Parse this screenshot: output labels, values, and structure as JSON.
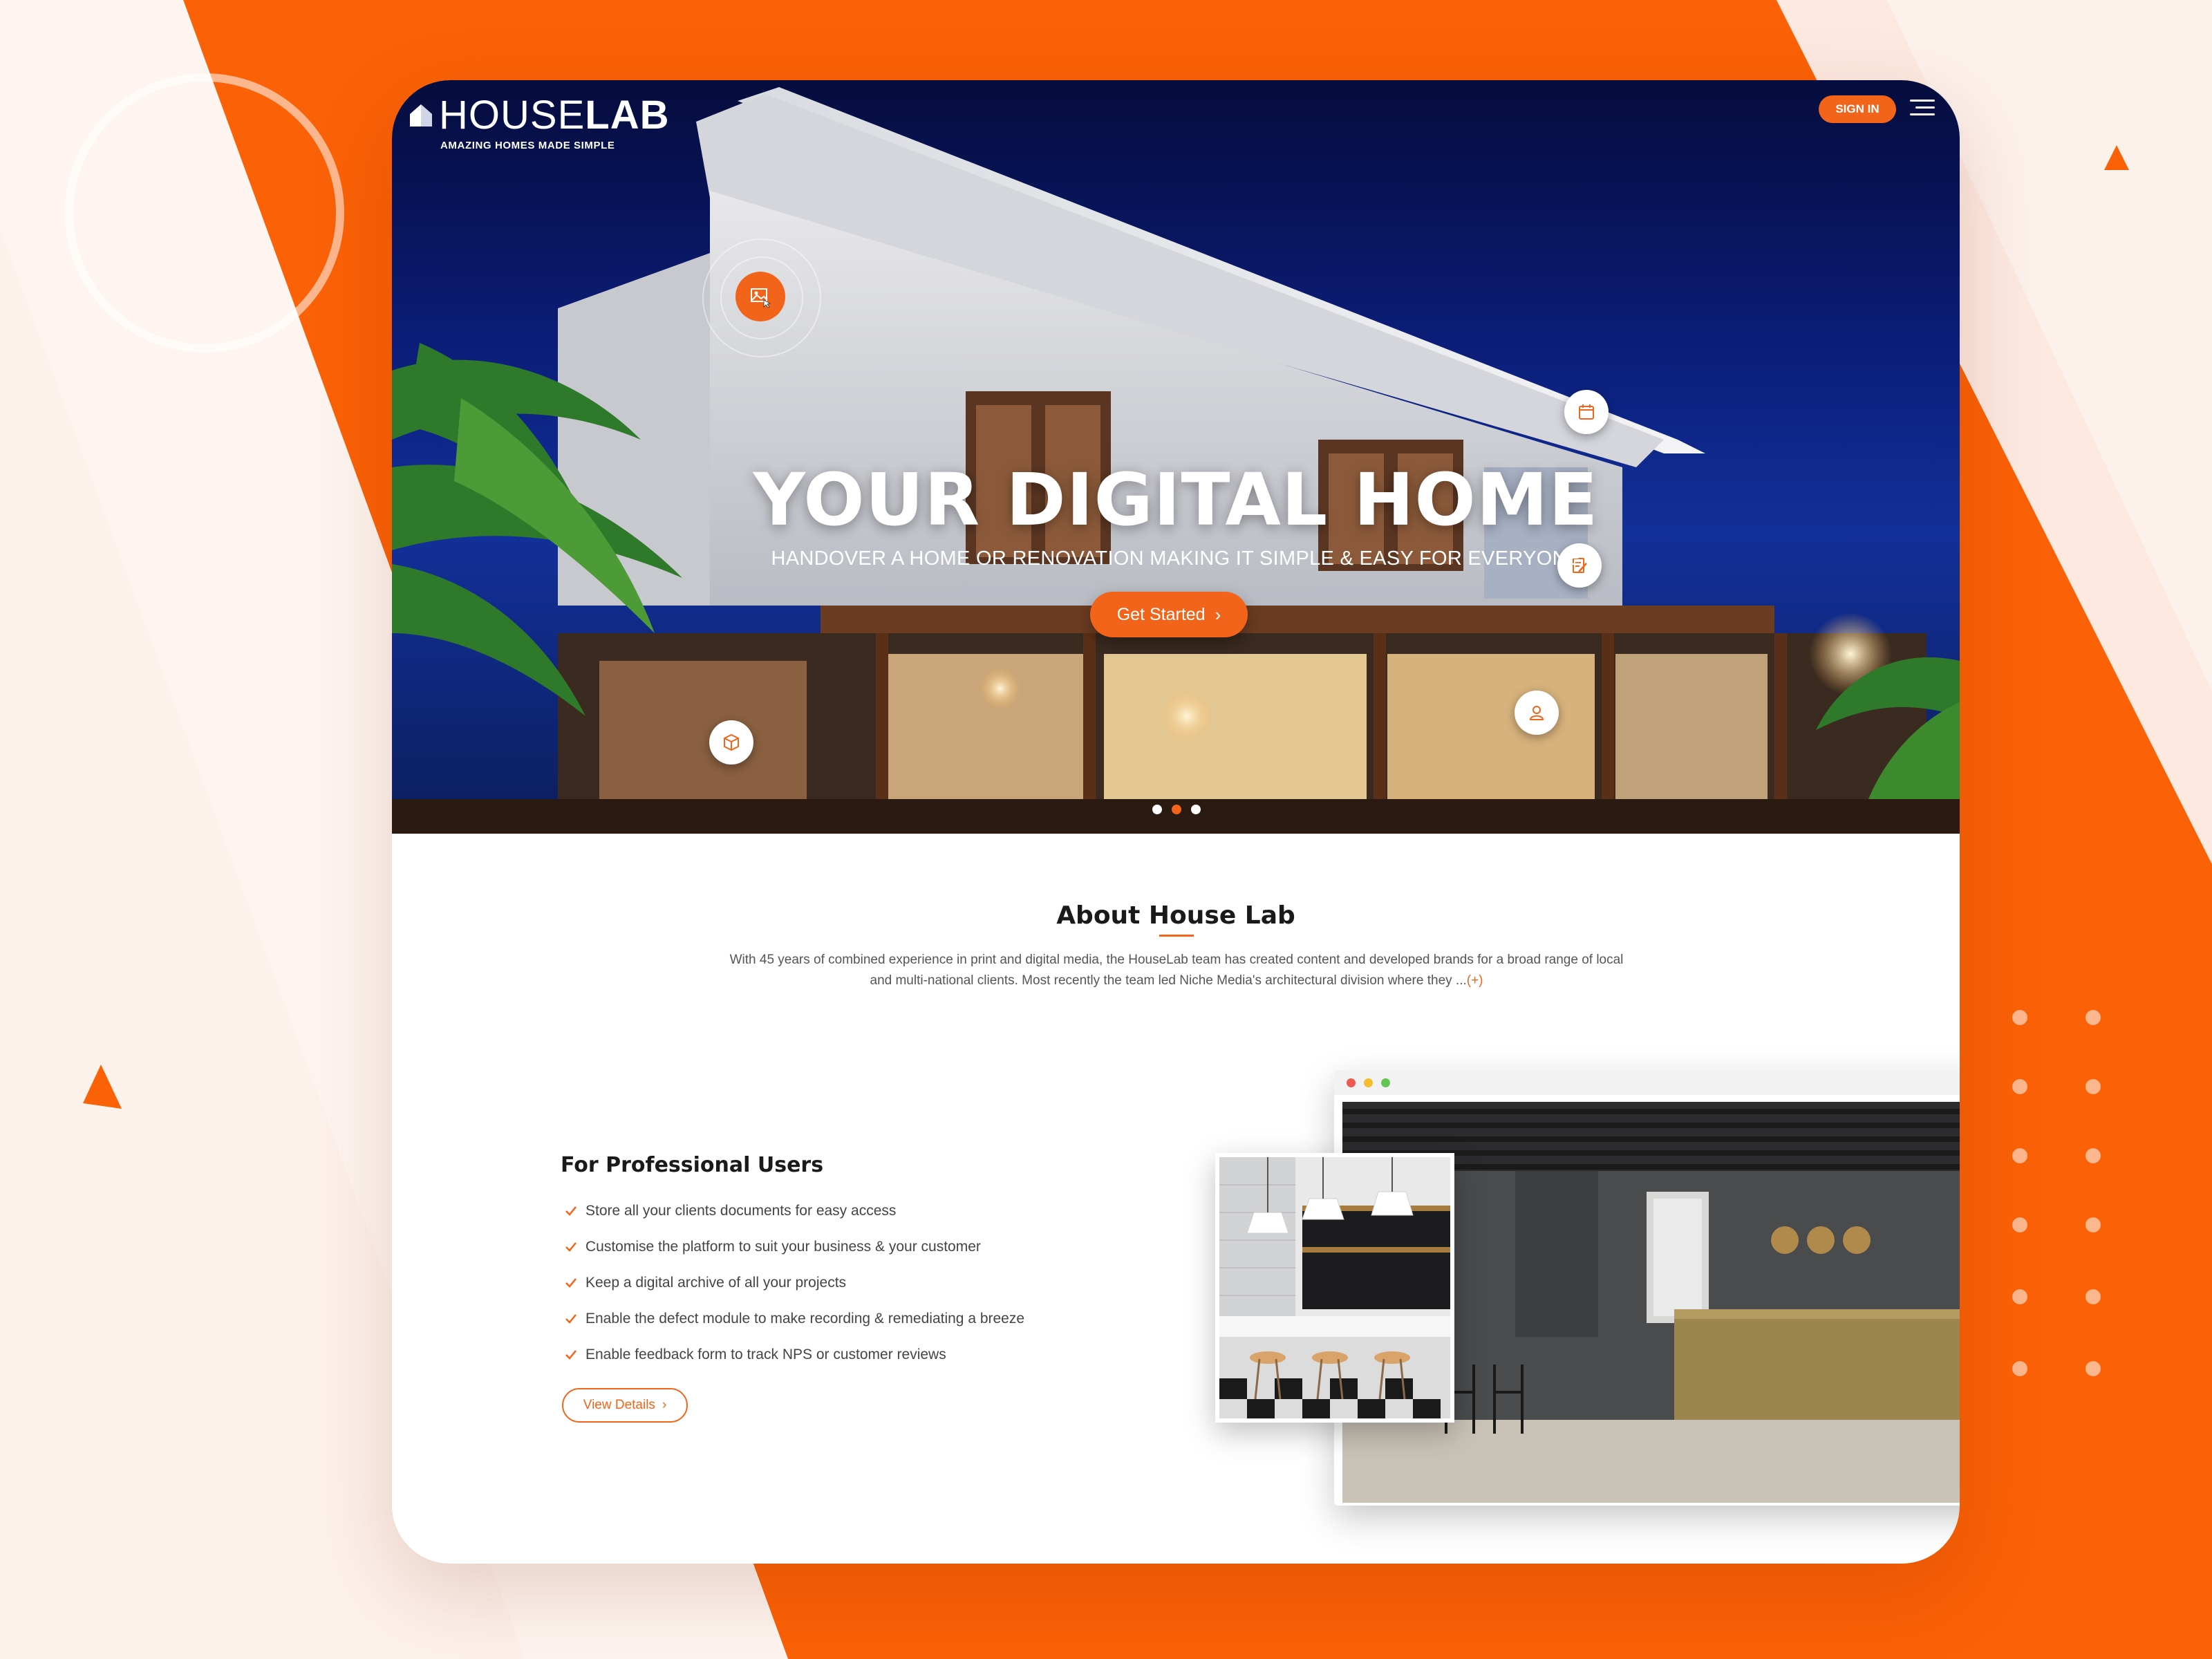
{
  "brand": {
    "name_light": "HOUSE",
    "name_bold": "LAB",
    "tagline": "AMAZING HOMES MADE SIMPLE"
  },
  "header": {
    "signin_label": "SIGN IN"
  },
  "hero": {
    "title": "YOUR DIGITAL HOME",
    "subtitle": "HANDOVER A HOME OR RENOVATION MAKING IT SIMPLE & EASY FOR EVERYONE",
    "cta_label": "Get Started",
    "slide_count": 3,
    "active_slide": 2
  },
  "about": {
    "title": "About House Lab",
    "body": "With 45 years of combined experience in print and digital media, the HouseLab team has created content and developed brands for a broad range of local and multi-national clients. Most recently the team led Niche Media's architectural division where they ...",
    "more_label": "(+)"
  },
  "professional": {
    "title": "For Professional Users",
    "features": [
      "Store all your clients documents for easy access",
      "Customise the platform to suit your business & your customer",
      "Keep a digital archive of all your projects",
      "Enable the defect module to make recording & remediating a breeze",
      "Enable feedback form to track NPS or customer reviews"
    ],
    "details_label": "View Details"
  },
  "colors": {
    "accent": "#f26419",
    "background": "#fdf1eb",
    "hero_sky": "#0b1d78"
  },
  "icons": {
    "hero_hotspots": [
      "gallery-icon",
      "calendar-icon",
      "document-edit-icon",
      "box-icon",
      "user-icon"
    ],
    "check": "check-icon",
    "menu": "hamburger-menu-icon"
  }
}
